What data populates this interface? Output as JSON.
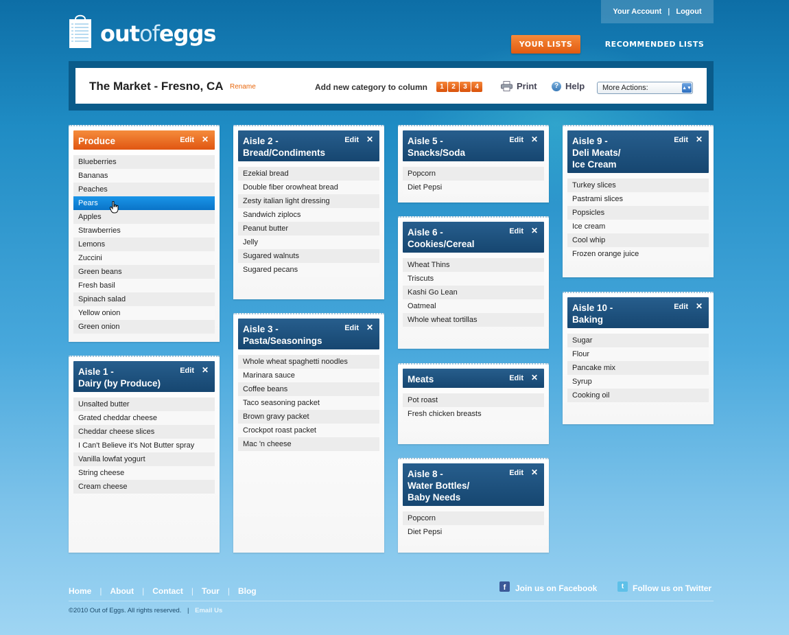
{
  "header": {
    "logo_text_a": "out",
    "logo_text_b": "of",
    "logo_text_c": "eggs",
    "account_link": "Your Account",
    "logout_link": "Logout",
    "separator": "|",
    "nav_your_lists": "YOUR LISTS",
    "nav_recommended": "RECOMMENDED LISTS"
  },
  "toolbar": {
    "list_name": "The Market - Fresno, CA",
    "rename": "Rename",
    "add_category_label": "Add new category to column",
    "columns": [
      "1",
      "2",
      "3",
      "4"
    ],
    "print": "Print",
    "help": "Help",
    "help_glyph": "?",
    "more_actions": "More Actions:",
    "more_actions_arrow": "▲▼"
  },
  "card_common": {
    "edit": "Edit",
    "close": "✕"
  },
  "cards": [
    {
      "title": "Produce",
      "color": "#e8661c",
      "items": [
        "Blueberries",
        "Bananas",
        "Peaches",
        "Pears",
        "Apples",
        "Strawberries",
        "Lemons",
        "Zuccini",
        "Green beans",
        "Fresh basil",
        "Spinach salad",
        "Yellow onion",
        "Green onion"
      ],
      "selected_index": 3
    },
    {
      "title": "Aisle 1 -\nDairy (by Produce)",
      "items": [
        "Unsalted butter",
        "Grated cheddar cheese",
        "Cheddar cheese slices",
        "I Can't Believe it's Not Butter spray",
        "Vanilla lowfat yogurt",
        "String cheese",
        "Cream cheese"
      ]
    },
    {
      "title": "Aisle 2 -\nBread/Condiments",
      "items": [
        "Ezekial bread",
        "Double fiber orowheat bread",
        "Zesty italian light dressing",
        "Sandwich ziplocs",
        "Peanut butter",
        "Jelly",
        "Sugared walnuts",
        "Sugared pecans"
      ]
    },
    {
      "title": "Aisle 3 -\nPasta/Seasonings",
      "items": [
        "Whole wheat spaghetti noodles",
        "Marinara sauce",
        "Coffee beans",
        "Taco seasoning packet",
        "Brown gravy packet",
        "Crockpot roast packet",
        "Mac 'n cheese"
      ]
    },
    {
      "title": "Aisle 5 -\nSnacks/Soda",
      "items": [
        "Popcorn",
        "Diet Pepsi"
      ]
    },
    {
      "title": "Aisle 6 -\nCookies/Cereal",
      "items": [
        "Wheat Thins",
        "Triscuts",
        "Kashi Go Lean",
        "Oatmeal",
        "Whole wheat tortillas"
      ]
    },
    {
      "title": "Meats",
      "items": [
        "Pot roast",
        "Fresh chicken breasts"
      ]
    },
    {
      "title": "Aisle 8 -\nWater Bottles/\nBaby Needs",
      "items": [
        "Popcorn",
        "Diet Pepsi"
      ]
    },
    {
      "title": "Aisle 9 -\nDeli Meats/\nIce Cream",
      "items": [
        "Turkey slices",
        "Pastrami slices",
        "Popsicles",
        "Ice cream",
        "Cool whip",
        "Frozen orange juice"
      ]
    },
    {
      "title": "Aisle 10 -\nBaking",
      "items": [
        "Sugar",
        "Flour",
        "Pancake mix",
        "Syrup",
        "Cooking oil"
      ]
    }
  ],
  "footer": {
    "links": [
      "Home",
      "About",
      "Contact",
      "Tour",
      "Blog"
    ],
    "separator": "|",
    "facebook": "Join us on Facebook",
    "facebook_glyph": "f",
    "twitter": "Follow us on Twitter",
    "twitter_glyph": "t",
    "copyright": "©2010 Out of Eggs. All rights reserved.",
    "email_us": "Email Us"
  }
}
